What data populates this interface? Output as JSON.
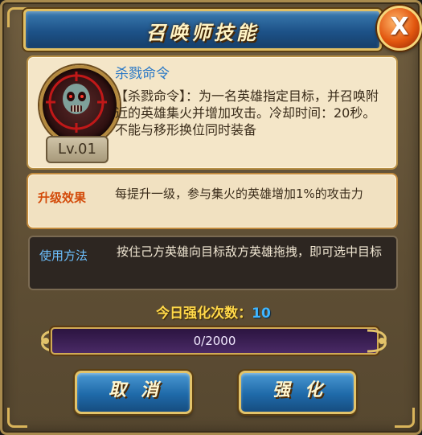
{
  "window": {
    "title": "召唤师技能",
    "close_label": "X"
  },
  "skill": {
    "name": "杀戮命令",
    "level": "Lv.01",
    "description": "【杀戮命令】：为一名英雄指定目标，并召唤附近的英雄集火并增加攻击。冷却时间：20秒。不能与移形换位同时装备"
  },
  "upgrade_effect": {
    "label": "升级效果",
    "text": "每提升一级，参与集火的英雄增加1%的攻击力"
  },
  "usage": {
    "label": "使用方法",
    "text": "按住己方英雄向目标敌方英雄拖拽，即可选中目标"
  },
  "daily": {
    "label": "今日强化次数：",
    "count": "10"
  },
  "progress": {
    "text": "0/2000",
    "fraction": 0
  },
  "buttons": {
    "cancel": "取消",
    "upgrade": "强化"
  },
  "colors": {
    "accent_gold": "#e1bf63",
    "title_blue": "#1d5288",
    "effect_orange": "#d34b0a",
    "usage_blue": "#6dc1ff"
  }
}
